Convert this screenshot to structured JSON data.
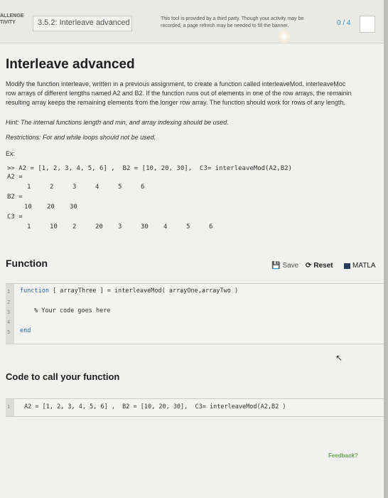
{
  "header": {
    "badge_line1": "ALLENGE",
    "badge_line2": "TIVITY",
    "breadcrumb": "3.5.2: Interleave advanced",
    "notice_line1": "This tool is provided by a third party. Though your activity may be",
    "notice_line2": "recorded, a page refresh may be needed to fill the banner.",
    "score": "0 / 4"
  },
  "title": "Interleave advanced",
  "description": {
    "line1": "Modify the function interleave, written in a previous assignment, to create a function called interleaveMod. interleaveMoc",
    "line2": "row arrays of different lengths named A2 and B2. If the function runs out of elements in one of the row arrays, the remainin",
    "line3": "resulting array keeps the remaining elements from the longer row array. The function should work for rows of any length.",
    "hint": "Hint: The internal functions length and min, and array indexing should be used.",
    "restrictions": "Restrictions: For and while loops should not be used.",
    "ex": "Ex:"
  },
  "example": {
    "cmd": ">> A2 = [1, 2, 3, 4, 5, 6] ,  B2 = [10, 20, 30],  C3= interleaveMod(A2,B2)",
    "a2_label": "A2 =",
    "a2_values": [
      "1",
      "2",
      "3",
      "4",
      "5",
      "6"
    ],
    "b2_label": "B2 =",
    "b2_values": [
      "10",
      "20",
      "30"
    ],
    "c3_label": "C3 =",
    "c3_values": [
      "1",
      "10",
      "2",
      "20",
      "3",
      "30",
      "4",
      "5",
      "6"
    ]
  },
  "function_section": {
    "title": "Function",
    "save": "Save",
    "reset": "Reset",
    "matlab": "MATLA",
    "lines": [
      "1",
      "2",
      "3",
      "4",
      "5"
    ],
    "code_line1_kw": "function",
    "code_line1_rest": " [ arrayThree ] = interleaveMod( arrayOne,arrayTwo )",
    "code_line3": "% Your code goes here",
    "code_line5": "end"
  },
  "call_section": {
    "title": "Code to call your function",
    "line_no": "1",
    "code": "A2 = [1, 2, 3, 4, 5, 6] ,  B2 = [10, 20, 30],  C3= interleaveMod(A2,B2 )"
  },
  "feedback": "Feedback?"
}
